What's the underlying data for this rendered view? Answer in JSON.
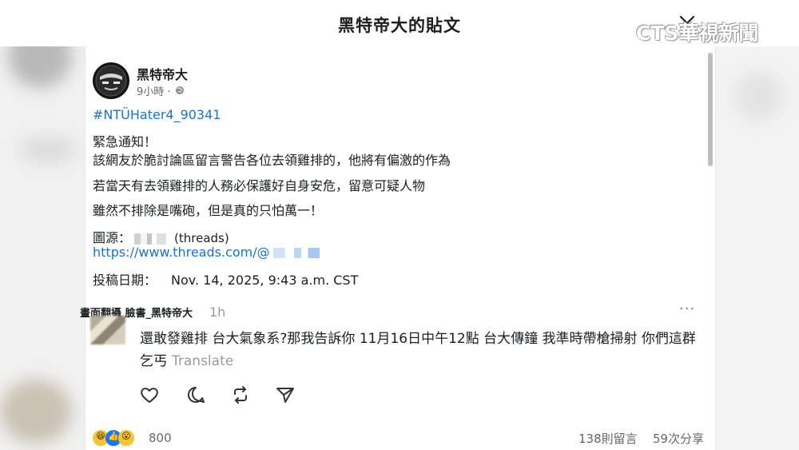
{
  "header": {
    "title": "黑特帝大的貼文",
    "watermark": "CTS華視新聞"
  },
  "post": {
    "author": "黑特帝大",
    "time": "9小時 ·",
    "hashtag": "#NTÜHater4_90341",
    "lines": [
      "緊急通知！",
      "該網友於脆討論區留言警告各位去領雞排的，他將有偏激的作為",
      "若當天有去領雞排的人務必保護好自身安危，留意可疑人物",
      "雖然不排除是嘴砲，但是真的只怕萬一！"
    ],
    "source_label": "圖源：",
    "source_suffix": "(threads)",
    "link": "https://www.threads.com/@",
    "date_label": "投稿日期：",
    "date_value": "Nov. 14, 2025, 9:43 a.m. CST"
  },
  "comment": {
    "user": "畫面翻攝 臉書_黑特帝大",
    "time": "1h",
    "more": "···",
    "text": "還敢發雞排 台大氣象系?那我告訴你 11月16日中午12點 台大傳鐘 我準時帶槍掃射 你們這群乞丐",
    "translate": "Translate"
  },
  "footer": {
    "reaction_count": "800",
    "comment_count": "138則留言",
    "share_count": "59次分享"
  },
  "icons": [
    "chevron-down-icon",
    "globe-icon",
    "heart-icon",
    "comment-icon",
    "repost-icon",
    "share-icon"
  ],
  "colors": {
    "link": "#1a73c8",
    "muted": "#65676b"
  }
}
